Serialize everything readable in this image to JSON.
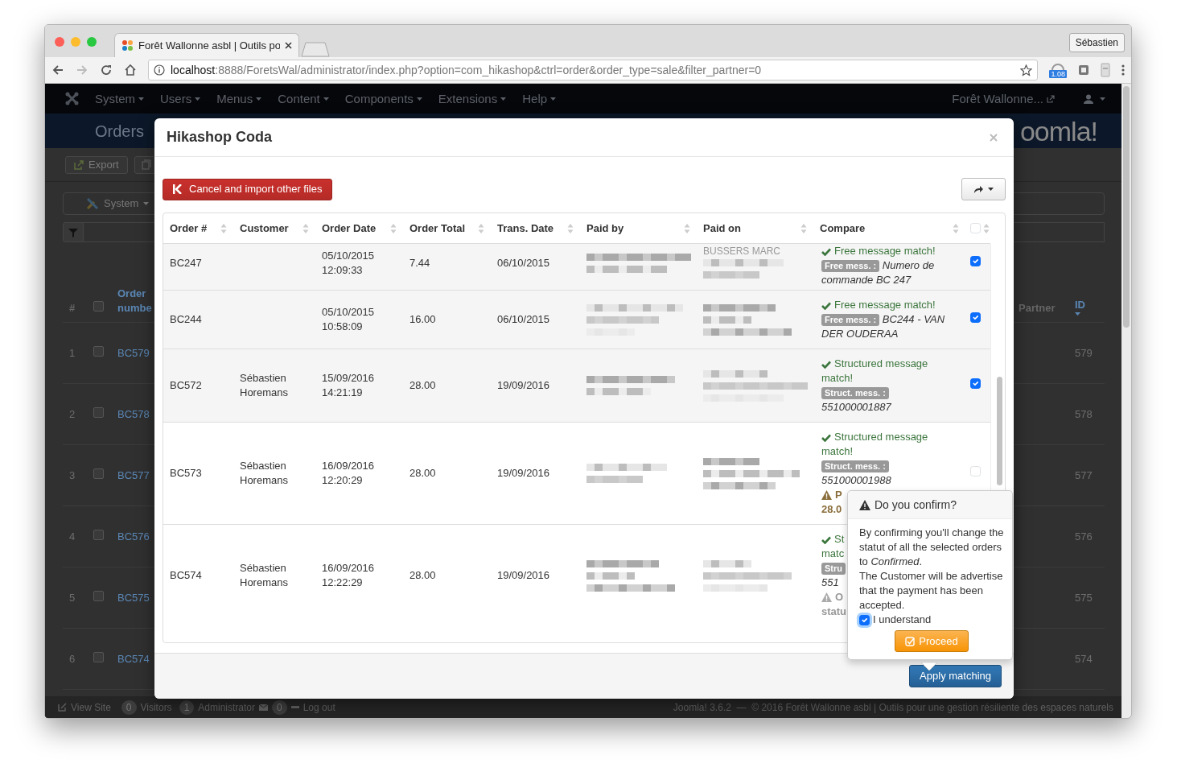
{
  "browser": {
    "tab_title": "Forêt Wallonne asbl | Outils po",
    "profile_button": "Sébastien",
    "url_host": "localhost",
    "url_path": ":8888/ForetsWal/administrator/index.php?option=com_hikashop&ctrl=order&order_type=sale&filter_partner=0",
    "extension_badge": "1.08"
  },
  "admin": {
    "menu": [
      "System",
      "Users",
      "Menus",
      "Content",
      "Components",
      "Extensions",
      "Help"
    ],
    "site_link": "Forêt Wallonne...",
    "page_title": "Orders",
    "logo_text": "oomla!",
    "export_button": "Export",
    "filter_dropdown": "System",
    "list_header": {
      "number": "#",
      "order_number": "Order numbe",
      "partner": "Partner",
      "id": "ID"
    },
    "select_all_checked": false,
    "rows": [
      {
        "number": "1",
        "order": "BC579",
        "id": "579",
        "checked": false
      },
      {
        "number": "2",
        "order": "BC578",
        "id": "578",
        "checked": false
      },
      {
        "number": "3",
        "order": "BC577",
        "id": "577",
        "checked": false
      },
      {
        "number": "4",
        "order": "BC576",
        "id": "576",
        "checked": false
      },
      {
        "number": "5",
        "order": "BC575",
        "id": "575",
        "checked": false
      },
      {
        "number": "6",
        "order": "BC574",
        "id": "574",
        "checked": false
      }
    ],
    "footer": {
      "view_site": "View Site",
      "visitors_count": "0",
      "visitors": "Visitors",
      "admin_count": "1",
      "administrator": "Administrator",
      "messages_count": "0",
      "logout": "Log out",
      "copyright": "Joomla! 3.6.2  —  © 2016 Forêt Wallonne asbl | Outils pour une gestion résiliente des espaces naturels"
    }
  },
  "modal": {
    "title": "Hikashop Coda",
    "cancel_button": "Cancel and import other files",
    "columns": [
      "Order #",
      "Customer",
      "Order Date",
      "Order Total",
      "Trans. Date",
      "Paid by",
      "Paid on",
      "Compare"
    ],
    "select_all_checked": false,
    "rows": [
      {
        "order": "BC247",
        "order_date": "05/10/2015 12:09:33",
        "order_total": "7.44",
        "trans_date": "06/10/2015",
        "paid_on_name": "BUSSERS MARC",
        "checked": true,
        "compare": [
          {
            "kind": "match",
            "text": "Free message match!"
          },
          {
            "kind": "tag",
            "label": "Free mess. :",
            "value": "Numero de commande BC 247"
          }
        ]
      },
      {
        "order": "BC244",
        "order_date": "05/10/2015 10:58:09",
        "order_total": "16.00",
        "trans_date": "06/10/2015",
        "checked": true,
        "compare": [
          {
            "kind": "match",
            "text": "Free message match!"
          },
          {
            "kind": "tag",
            "label": "Free mess. :",
            "value": "BC244 - VAN DER OUDERAA"
          }
        ]
      },
      {
        "order": "BC572",
        "customer": "Sébastien Horemans",
        "order_date": "15/09/2016 14:21:19",
        "order_total": "28.00",
        "trans_date": "19/09/2016",
        "checked": true,
        "compare": [
          {
            "kind": "match",
            "text": "Structured message match!"
          },
          {
            "kind": "tag",
            "label": "Struct. mess. :",
            "value": "551000001887"
          }
        ]
      },
      {
        "order": "BC573",
        "customer": "Sébastien Horemans",
        "order_date": "16/09/2016 12:20:29",
        "order_total": "28.00",
        "trans_date": "19/09/2016",
        "checked": false,
        "compare": [
          {
            "kind": "match",
            "text": "Structured message match!"
          },
          {
            "kind": "tag",
            "label": "Struct. mess. :",
            "value": "551000001988"
          },
          {
            "kind": "warning",
            "text": "P"
          },
          {
            "kind": "amount",
            "text": "28.0"
          }
        ]
      },
      {
        "order": "BC574",
        "customer": "Sébastien Horemans",
        "order_date": "16/09/2016 12:22:29",
        "order_total": "28.00",
        "trans_date": "19/09/2016",
        "compare": [
          {
            "kind": "match",
            "text": "St"
          },
          {
            "kind": "match-rest",
            "text": "matc"
          },
          {
            "kind": "tag",
            "label": "Stru"
          },
          {
            "kind": "value",
            "text": "551"
          },
          {
            "kind": "note",
            "text": "O"
          },
          {
            "kind": "note-rest",
            "text": "statu"
          }
        ]
      }
    ],
    "apply_button": "Apply matching"
  },
  "popover": {
    "title": "Do you confirm?",
    "message": "By confirming you'll change the statut of all the selected orders to *Confirmed*.",
    "message_2": "The Customer will be advertise that the payment has been accepted.",
    "understand": {
      "label": "I understand",
      "checked": true
    },
    "proceed_button": "Proceed"
  }
}
